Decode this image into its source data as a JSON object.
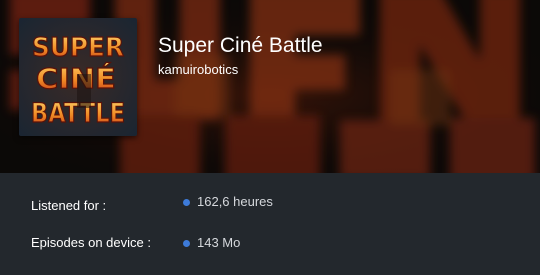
{
  "podcast": {
    "title": "Super Ciné Battle",
    "author": "kamuirobotics",
    "cover_art_text": [
      "SUPER",
      "CINÉ",
      "BATTLE"
    ]
  },
  "stats": [
    {
      "label": "Listened for :",
      "value": "162,6 heures"
    },
    {
      "label": "Episodes on device :",
      "value": "143 Mo"
    }
  ],
  "colors": {
    "stats_background": "#23282d",
    "indicator_dot": "#3d7bd9",
    "cover_text": "#f08a24",
    "cover_background": "#1c2a3a"
  }
}
